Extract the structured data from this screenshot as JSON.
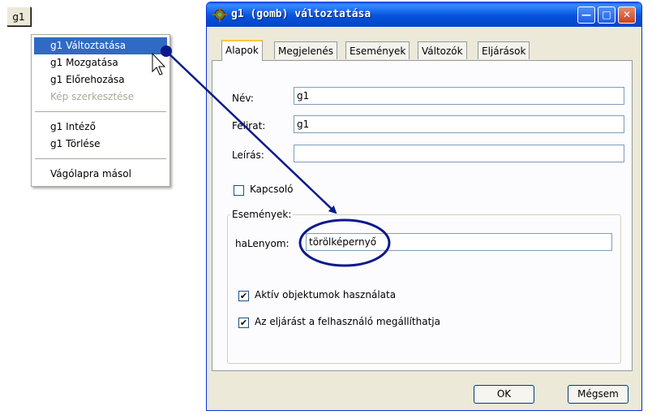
{
  "toolbar": {
    "g1_label": "g1"
  },
  "context_menu": {
    "items": [
      {
        "label": "g1 Változtatása"
      },
      {
        "label": "g1 Mozgatása"
      },
      {
        "label": "g1 Előrehozása"
      },
      {
        "label": "Kép szerkesztése"
      },
      {
        "label": "g1 Intéző"
      },
      {
        "label": "g1 Törlése"
      },
      {
        "label": "Vágólapra másol"
      }
    ]
  },
  "dialog": {
    "title": "g1 (gomb) változtatása",
    "tabs": [
      {
        "label": "Alapok"
      },
      {
        "label": "Megjelenés"
      },
      {
        "label": "Események"
      },
      {
        "label": "Változók"
      },
      {
        "label": "Eljárások"
      }
    ],
    "fields": {
      "nev_label": "Név:",
      "nev_value": "g1",
      "felirat_label": "Felirat:",
      "felirat_value": "g1",
      "leiras_label": "Leírás:",
      "leiras_value": ""
    },
    "kapcsolo_label": "Kapcsoló",
    "kapcsolo_checked": false,
    "events_group": {
      "title": "Események:",
      "halenyom_label": "haLenyom:",
      "halenyom_value": "törölképernyő",
      "aktiv_label": "Aktív objektumok használata",
      "aktiv_checked": true,
      "megallithat_label": "Az eljárást a felhasználó megállíthatja",
      "megallithat_checked": true
    },
    "ok_label": "OK",
    "cancel_label": "Mégsem"
  },
  "annotation_color": "#0a1a8c"
}
